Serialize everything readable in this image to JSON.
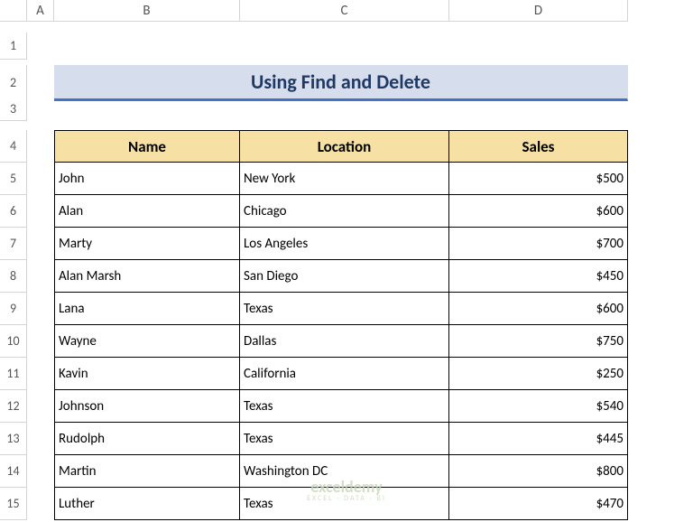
{
  "columns": [
    "A",
    "B",
    "C",
    "D"
  ],
  "rows": [
    "1",
    "2",
    "3",
    "4",
    "5",
    "6",
    "7",
    "8",
    "9",
    "10",
    "11",
    "12",
    "13",
    "14",
    "15"
  ],
  "title": "Using Find and Delete",
  "headers": {
    "name": "Name",
    "location": "Location",
    "sales": "Sales"
  },
  "chart_data": {
    "type": "table",
    "title": "Using Find and Delete",
    "columns": [
      "Name",
      "Location",
      "Sales"
    ],
    "rows": [
      {
        "name": "John",
        "location": "New York",
        "sales": "$500"
      },
      {
        "name": "Alan",
        "location": "Chicago",
        "sales": "$600"
      },
      {
        "name": "Marty",
        "location": "Los Angeles",
        "sales": "$700"
      },
      {
        "name": "Alan Marsh",
        "location": "San Diego",
        "sales": "$450"
      },
      {
        "name": "Lana",
        "location": "Texas",
        "sales": "$600"
      },
      {
        "name": "Wayne",
        "location": "Dallas",
        "sales": "$750"
      },
      {
        "name": "Kavin",
        "location": "California",
        "sales": "$250"
      },
      {
        "name": "Johnson",
        "location": "Texas",
        "sales": "$540"
      },
      {
        "name": "Rudolph",
        "location": "Texas",
        "sales": "$445"
      },
      {
        "name": "Martin",
        "location": "Washington DC",
        "sales": "$800"
      },
      {
        "name": "Luther",
        "location": "Texas",
        "sales": "$470"
      }
    ]
  },
  "watermark": {
    "name": "exceldemy",
    "tag": "EXCEL · DATA · BI"
  }
}
